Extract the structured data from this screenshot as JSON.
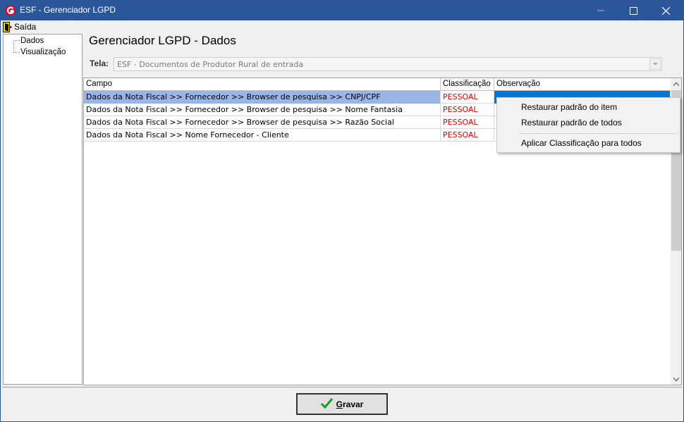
{
  "window": {
    "title": "ESF - Gerenciador LGPD"
  },
  "menu": {
    "exit_label": "Saída"
  },
  "tree": {
    "items": [
      "Dados",
      "Visualização"
    ]
  },
  "page": {
    "title": "Gerenciador LGPD - Dados"
  },
  "tela": {
    "label": "Tela:",
    "value": "ESF - Documentos de Produtor Rural de entrada"
  },
  "grid": {
    "columns": [
      "Campo",
      "Classificação",
      "Observação"
    ],
    "rows": [
      {
        "campo": "Dados da Nota Fiscal  >>  Fornecedor >> Browser de pesquisa >> CNPJ/CPF",
        "classificacao": "PESSOAL",
        "observacao": ""
      },
      {
        "campo": "Dados da Nota Fiscal  >>  Fornecedor >> Browser de pesquisa >> Nome Fantasia",
        "classificacao": "PESSOAL",
        "observacao": ""
      },
      {
        "campo": "Dados da Nota Fiscal  >>  Fornecedor >> Browser de pesquisa >> Razão Social",
        "classificacao": "PESSOAL",
        "observacao": ""
      },
      {
        "campo": "Dados da Nota Fiscal  >> Nome Fornecedor - Cliente",
        "classificacao": "PESSOAL",
        "observacao": ""
      }
    ]
  },
  "context_menu": {
    "items": [
      "Restaurar padrão do item",
      "Restaurar padrão de todos",
      "Aplicar Classificação para todos"
    ]
  },
  "footer": {
    "save_first": "G",
    "save_rest": "ravar"
  },
  "colors": {
    "titlebar": "#2b579a",
    "selected_row": "#99b4e6",
    "classification": "#e00000"
  }
}
